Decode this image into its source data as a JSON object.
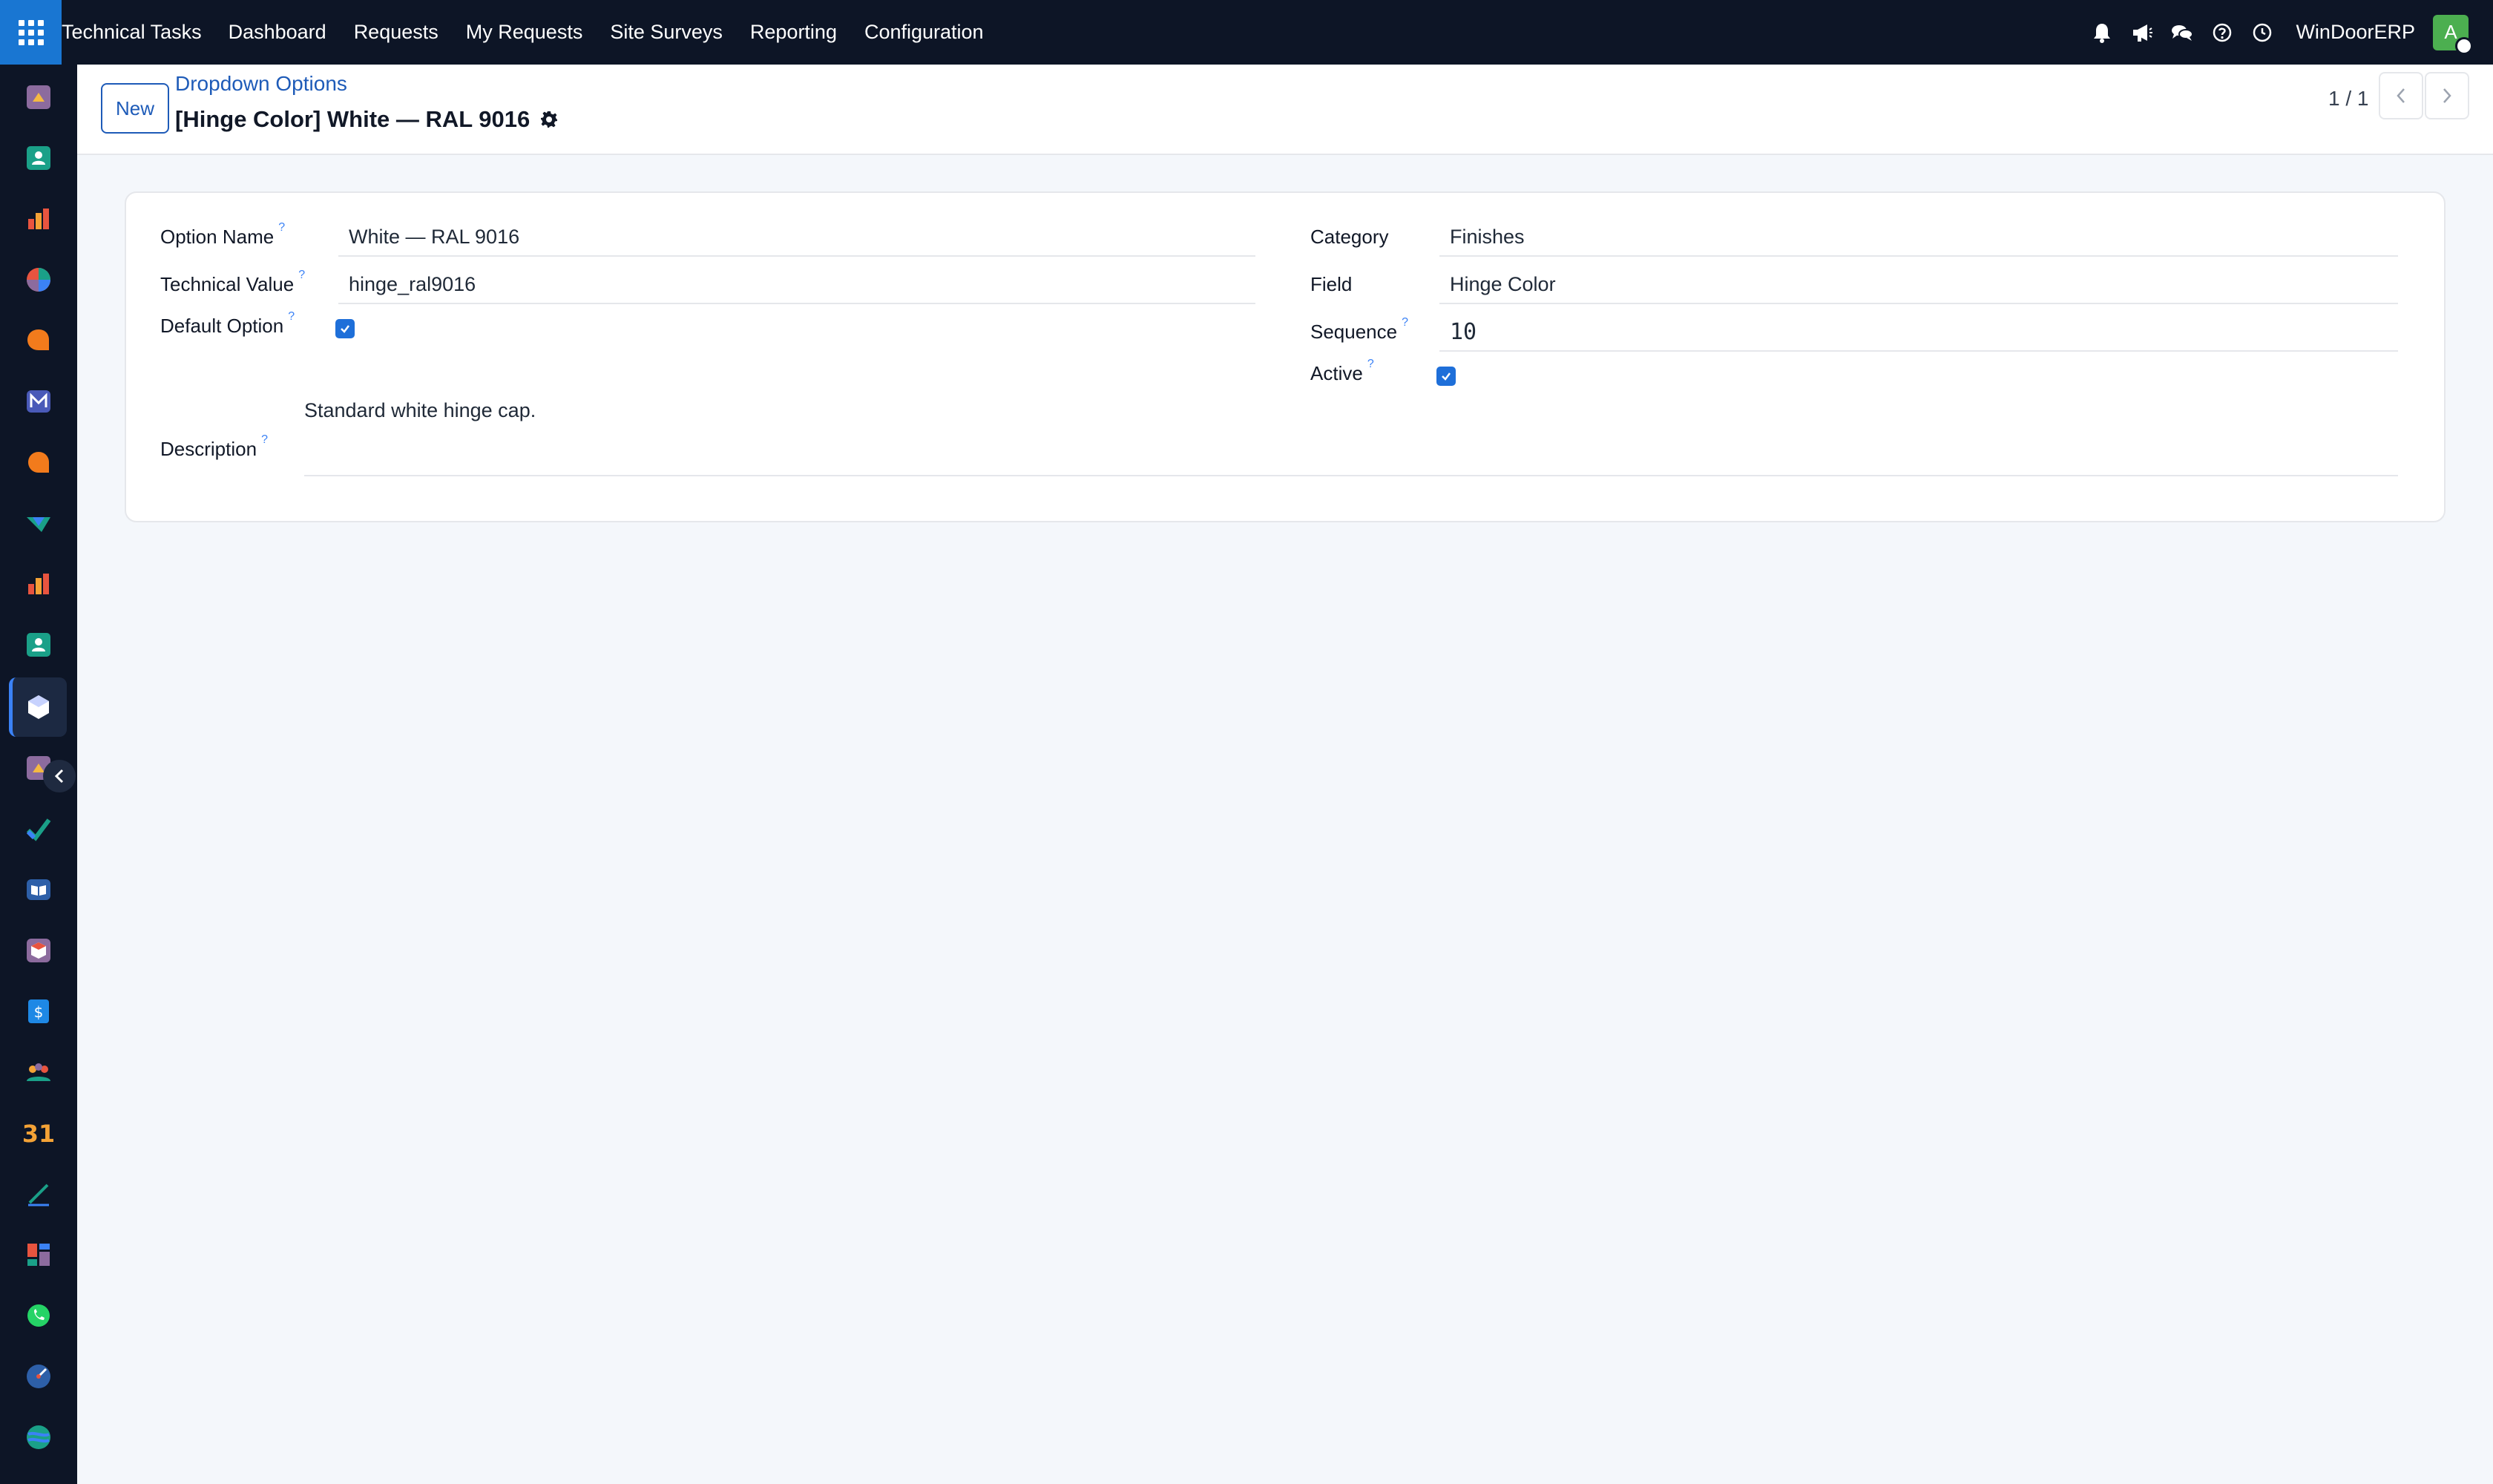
{
  "topbar": {
    "app_name": "Technical Tasks",
    "menu": [
      "Dashboard",
      "Requests",
      "My Requests",
      "Site Surveys",
      "Reporting",
      "Configuration"
    ],
    "company": "WinDoorERP",
    "avatar_letter": "A",
    "icons": [
      "bell-icon",
      "megaphone-icon",
      "chat-icon",
      "help-icon",
      "clock-icon"
    ]
  },
  "sidebar": {
    "icons": [
      "app-1-icon",
      "contacts-icon",
      "reports-icon",
      "pie-icon",
      "discuss-icon",
      "mail-icon",
      "discuss-2-icon",
      "sales-icon",
      "inventory-icon",
      "employees-icon",
      "technical-tasks-icon",
      "app-12-icon",
      "todo-icon",
      "knowledge-icon",
      "product-icon",
      "invoice-icon",
      "team-icon",
      "calendar-icon",
      "sign-icon",
      "dashboards-icon",
      "whatsapp-icon",
      "clock-app-icon",
      "website-icon"
    ],
    "active_index": 10
  },
  "control": {
    "new_label": "New",
    "breadcrumb": "Dropdown Options",
    "title": "[Hinge Color] White — RAL 9016",
    "pager": "1 / 1"
  },
  "form": {
    "option_name_label": "Option Name",
    "option_name_value": "White — RAL 9016",
    "technical_value_label": "Technical Value",
    "technical_value_value": "hinge_ral9016",
    "default_option_label": "Default Option",
    "default_option_checked": true,
    "category_label": "Category",
    "category_value": "Finishes",
    "field_label": "Field",
    "field_value": "Hinge Color",
    "sequence_label": "Sequence",
    "sequence_value": "10",
    "active_label": "Active",
    "active_checked": true,
    "description_label": "Description",
    "description_value": "Standard white hinge cap.",
    "help_mark": "?"
  },
  "colors": {
    "navbar": "#0d1526",
    "accent": "#1976d2",
    "link": "#1e5bb8",
    "checkbox": "#1e6fd9",
    "avatar": "#4caf50"
  }
}
